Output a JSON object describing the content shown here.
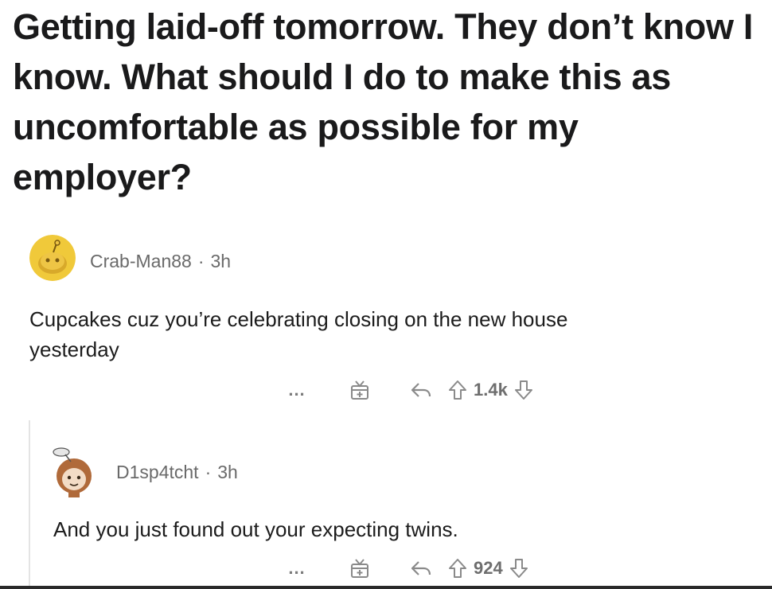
{
  "post": {
    "title": "Getting laid-off tomorrow. They don’t know I know. What should I do to make this as uncomfortable as possible for my employer?"
  },
  "comments": [
    {
      "username": "Crab-Man88",
      "separator": "·",
      "age": "3h",
      "body": "Cupcakes cuz you’re celebrating closing on the new house yesterday",
      "more": "...",
      "votes": "1.4k"
    },
    {
      "username": "D1sp4tcht",
      "separator": "·",
      "age": "3h",
      "body": "And you just found out your expecting twins.",
      "more": "...",
      "votes": "924"
    }
  ],
  "colors": {
    "avatar_yellow": "#f0c93a",
    "meta_gray": "#6a6a6a",
    "icon_gray": "#7c7c7c"
  },
  "icons": {
    "more": "more-options-icon",
    "award": "award-icon",
    "reply": "reply-icon",
    "upvote": "upvote-arrow-icon",
    "downvote": "downvote-arrow-icon"
  }
}
